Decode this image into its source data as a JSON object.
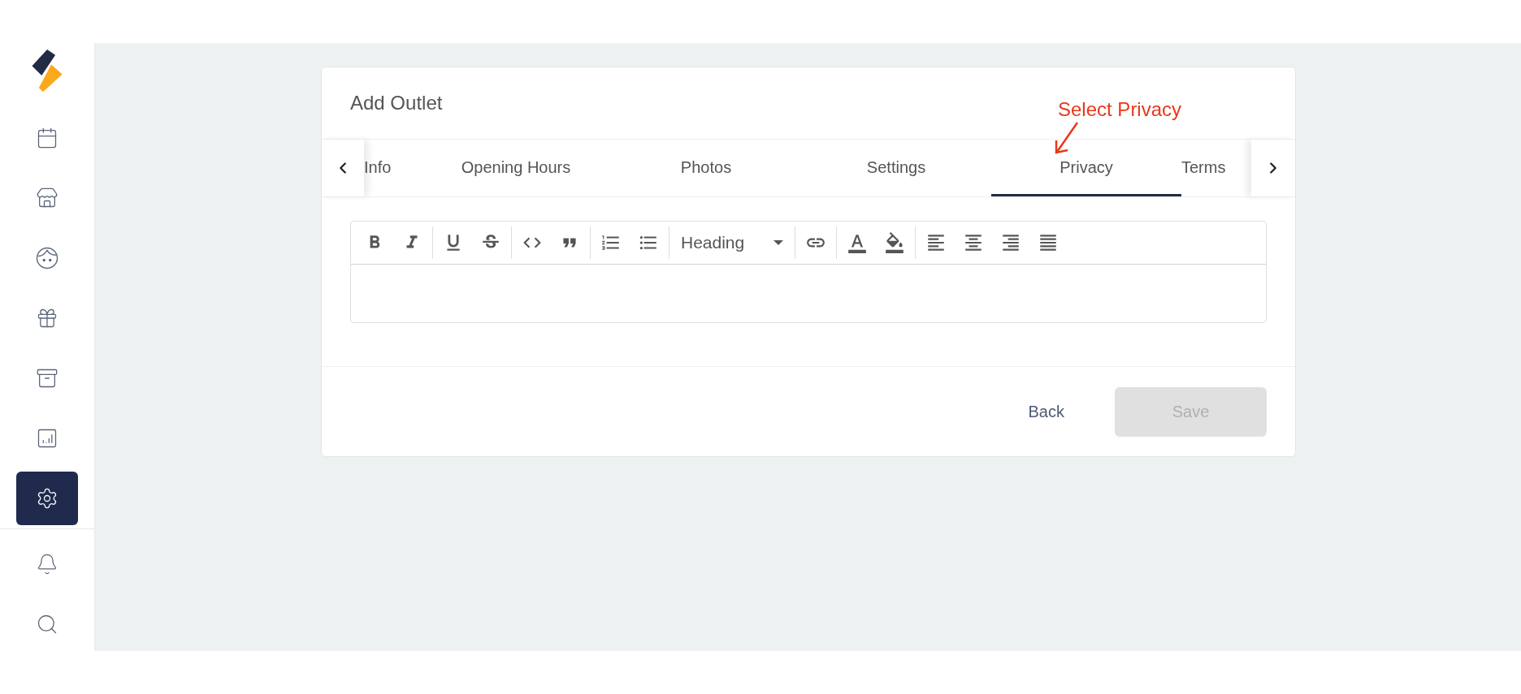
{
  "sidebar": {
    "items": [
      {
        "kind": "calendar",
        "selected": false
      },
      {
        "kind": "store",
        "selected": false
      },
      {
        "kind": "face",
        "selected": false
      },
      {
        "kind": "gift",
        "selected": false
      },
      {
        "kind": "archive",
        "selected": false
      },
      {
        "kind": "chart",
        "selected": false
      },
      {
        "kind": "settings",
        "selected": true
      }
    ],
    "bottom_items": [
      {
        "kind": "bell"
      },
      {
        "kind": "search"
      }
    ]
  },
  "card": {
    "title": "Add Outlet",
    "annotation": {
      "text": "Select Privacy"
    },
    "tabs": [
      {
        "label": "Info",
        "selected": false
      },
      {
        "label": "Opening Hours",
        "selected": false
      },
      {
        "label": "Photos",
        "selected": false
      },
      {
        "label": "Settings",
        "selected": false
      },
      {
        "label": "Privacy",
        "selected": true
      },
      {
        "label": "Terms",
        "selected": false
      }
    ],
    "toolbar": [
      [
        {
          "kind": "bold"
        },
        {
          "kind": "italic"
        }
      ],
      [
        {
          "kind": "underline"
        },
        {
          "kind": "strike"
        }
      ],
      [
        {
          "kind": "code"
        },
        {
          "kind": "quote"
        }
      ],
      [
        {
          "kind": "ordered-list"
        },
        {
          "kind": "bullet-list"
        }
      ],
      [
        {
          "kind": "dropdown",
          "value": "Heading"
        }
      ],
      [
        {
          "kind": "link"
        }
      ],
      [
        {
          "kind": "text-color"
        },
        {
          "kind": "fill-color"
        }
      ],
      [
        {
          "kind": "align-left"
        },
        {
          "kind": "align-center"
        },
        {
          "kind": "align-right"
        },
        {
          "kind": "align-justify"
        }
      ]
    ],
    "buttons": [
      {
        "label": "Back",
        "kind": "text",
        "disabled": false
      },
      {
        "label": "Save",
        "kind": "primary",
        "disabled": true
      }
    ]
  }
}
